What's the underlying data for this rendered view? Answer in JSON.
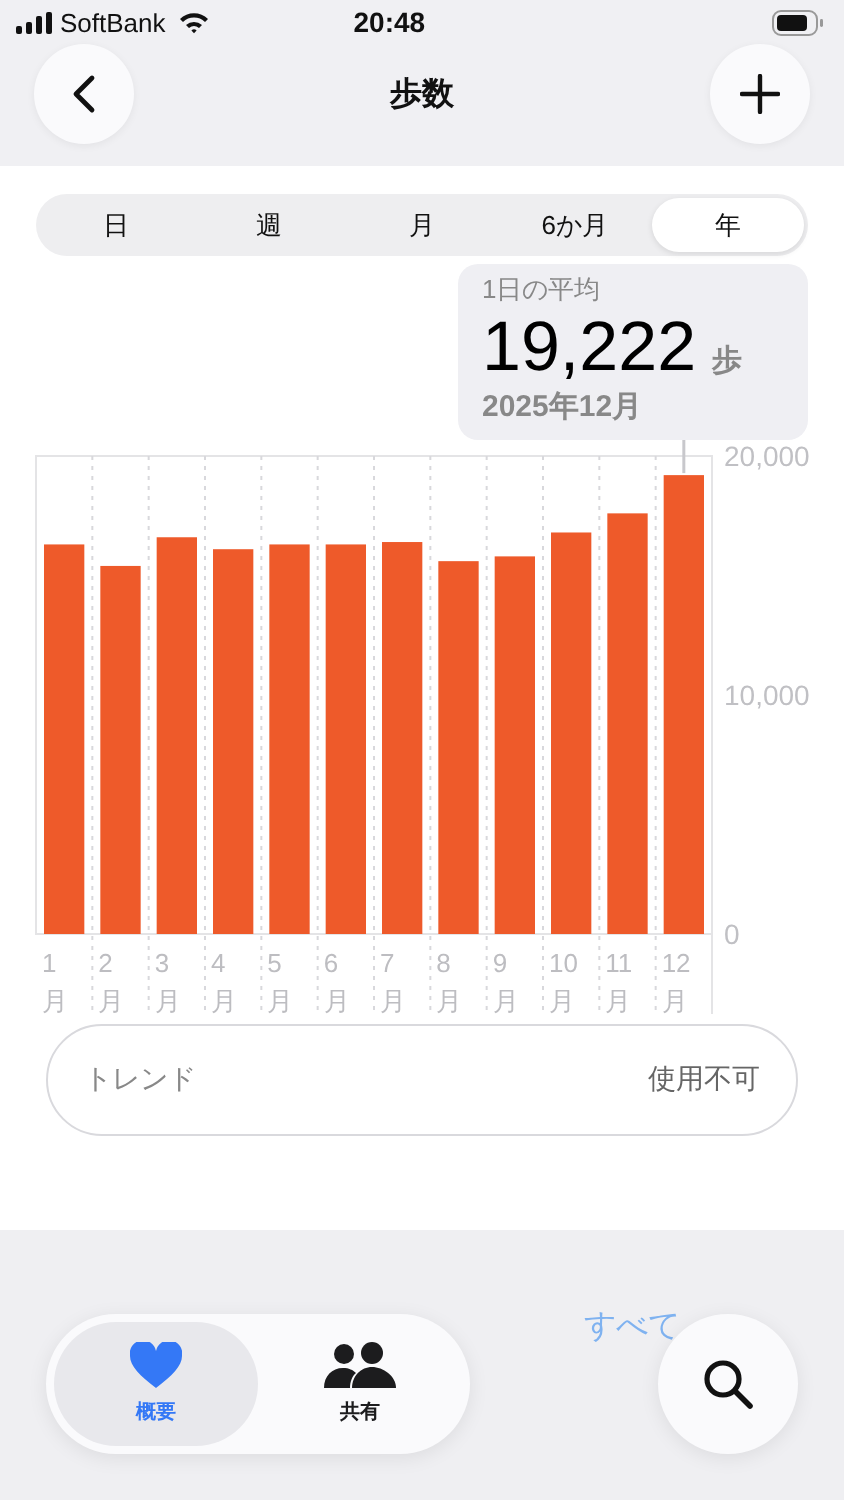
{
  "status_bar": {
    "carrier": "SoftBank",
    "time": "20:48"
  },
  "header": {
    "title": "歩数"
  },
  "tabs": [
    {
      "label": "日",
      "selected": false
    },
    {
      "label": "週",
      "selected": false
    },
    {
      "label": "月",
      "selected": false
    },
    {
      "label": "6か月",
      "selected": false
    },
    {
      "label": "年",
      "selected": true
    }
  ],
  "callout": {
    "label": "1日の平均",
    "value": "19,222",
    "unit": "歩",
    "date": "2025年12月"
  },
  "chart": {
    "chart_data": {
      "type": "bar",
      "categories": [
        "1月",
        "2月",
        "3月",
        "4月",
        "5月",
        "6月",
        "7月",
        "8月",
        "9月",
        "10月",
        "11月",
        "12月"
      ],
      "series": [
        {
          "color": "#ee5a2a",
          "values": [
            16300,
            15400,
            16600,
            16100,
            16300,
            16300,
            16400,
            15600,
            15800,
            16800,
            17600,
            19200
          ]
        }
      ],
      "ylim": [
        0,
        20000
      ],
      "yticks": [
        {
          "value": 0,
          "label": "0"
        },
        {
          "value": 10000,
          "label": "10,000"
        },
        {
          "value": 20000,
          "label": "20,000"
        }
      ]
    }
  },
  "trend": {
    "label": "トレンド",
    "value": "使用不可"
  },
  "section": {
    "link": "すべて"
  },
  "tab_bar": [
    {
      "label": "概要",
      "kind": "heart",
      "selected": true
    },
    {
      "label": "共有",
      "kind": "people",
      "selected": false
    }
  ]
}
